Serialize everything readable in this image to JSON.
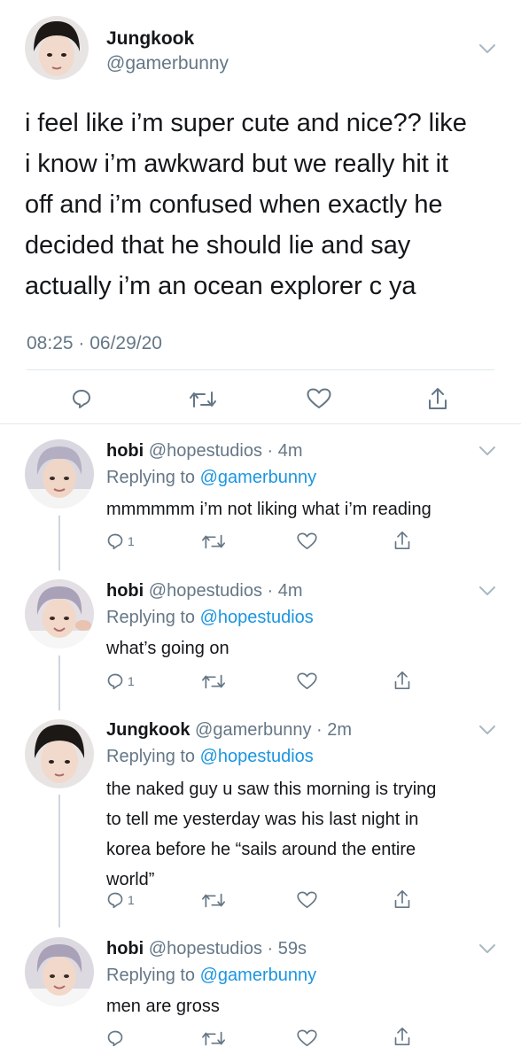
{
  "main_tweet": {
    "name": "Jungkook",
    "handle": "@gamerbunny",
    "lines": [
      "i feel like i’m super cute and nice?? like",
      "i know i’m awkward but we really hit it",
      "off and i’m confused when exactly he",
      "decided that he should lie and say",
      "actually i’m an ocean explorer c ya"
    ],
    "time": "08:25 · 06/29/20"
  },
  "replies": [
    {
      "name": "hobi",
      "handle": "@hopestudios",
      "age": "4m",
      "replying_label": "Replying to",
      "replying_to": "@gamerbunny",
      "lines": [
        "mmmmmm i’m not liking what i’m reading"
      ],
      "reply_count": "1"
    },
    {
      "name": "hobi",
      "handle": "@hopestudios",
      "age": "4m",
      "replying_label": "Replying to",
      "replying_to": "@hopestudios",
      "lines": [
        "what’s going on"
      ],
      "reply_count": "1"
    },
    {
      "name": "Jungkook",
      "handle": "@gamerbunny",
      "age": "2m",
      "replying_label": "Replying to",
      "replying_to": "@hopestudios",
      "lines": [
        "the naked guy u saw this morning is trying",
        "to tell me yesterday was his last night in",
        "korea before he “sails around the entire",
        "world”"
      ],
      "reply_count": "1"
    },
    {
      "name": "hobi",
      "handle": "@hopestudios",
      "age": "59s",
      "replying_label": "Replying to",
      "replying_to": "@gamerbunny",
      "lines": [
        "men are gross"
      ],
      "reply_count": ""
    }
  ],
  "colors": {
    "link": "#1b95e0",
    "secondary_text": "#657786",
    "divider": "#e1e8ed"
  },
  "icons": [
    "reply-icon",
    "retweet-icon",
    "like-icon",
    "share-icon",
    "chevron-down-icon"
  ]
}
